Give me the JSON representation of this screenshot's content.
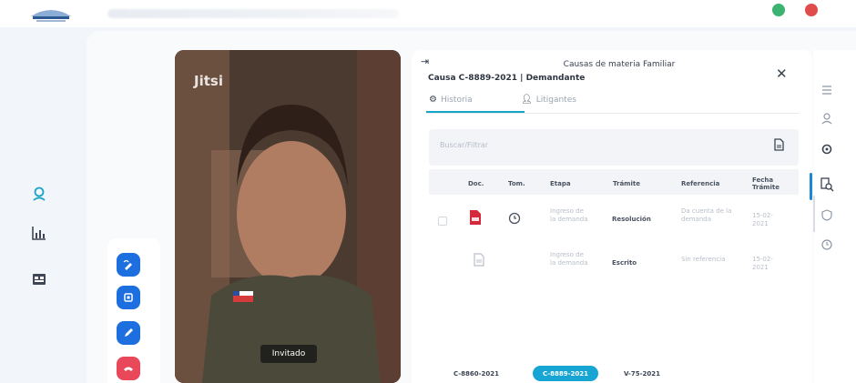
{
  "app": {
    "logo_icon": "institution-logo-icon",
    "status_colors": [
      "#3cb371",
      "#e04b4b"
    ]
  },
  "leftnav": {
    "items": [
      {
        "icon": "video-call-icon",
        "color": "#1aa3c9"
      },
      {
        "icon": "bar-chart-icon",
        "color": "#3d4756"
      },
      {
        "icon": "document-folder-icon",
        "color": "#3d4756"
      }
    ]
  },
  "controls": [
    {
      "icon": "edit-signature-icon",
      "color": "#1d6fe0"
    },
    {
      "icon": "stop-square-icon",
      "color": "#1d6fe0"
    },
    {
      "icon": "pen-icon",
      "color": "#1d6fe0"
    },
    {
      "icon": "end-call-icon",
      "color": "#e8485a"
    }
  ],
  "video": {
    "watermark": "Jitsi",
    "participant_label": "Invitado"
  },
  "panel": {
    "title": "Causas de materia Familiar",
    "subtitle": "Causa C-8889-2021 | Demandante",
    "tabs": [
      {
        "label": "Historia",
        "icon": "settings-gear-icon",
        "active": true
      },
      {
        "label": "Litigantes",
        "icon": "user-icon",
        "active": false
      }
    ],
    "search_placeholder": "Buscar/Filtrar",
    "table": {
      "headers": [
        "Doc.",
        "Tom.",
        "Etapa",
        "Trámite",
        "Referencia",
        "Fecha Trámite"
      ],
      "rows": [
        {
          "doc_icon": "pdf-file-icon",
          "tom_icon": "clock-icon",
          "etapa": "Ingreso de la demanda",
          "tramite": "Resolución",
          "referencia": "Da cuenta de la demanda",
          "fecha": "15-02-2021"
        },
        {
          "doc_icon": "file-icon",
          "tom_icon": "",
          "etapa": "Ingreso de la demanda",
          "tramite": "Escrito",
          "referencia": "Sin referencia",
          "fecha": "15-02-2021"
        }
      ]
    },
    "cause_pills": [
      {
        "label": "C-8860-2021",
        "active": false
      },
      {
        "label": "C-8889-2021",
        "active": true
      },
      {
        "label": "V-75-2021",
        "active": false
      }
    ]
  },
  "rail": {
    "icons": [
      "menu-lines-icon",
      "user-icon",
      "settings-gear-icon",
      "search-document-icon",
      "shield-icon",
      "clock-icon"
    ]
  }
}
